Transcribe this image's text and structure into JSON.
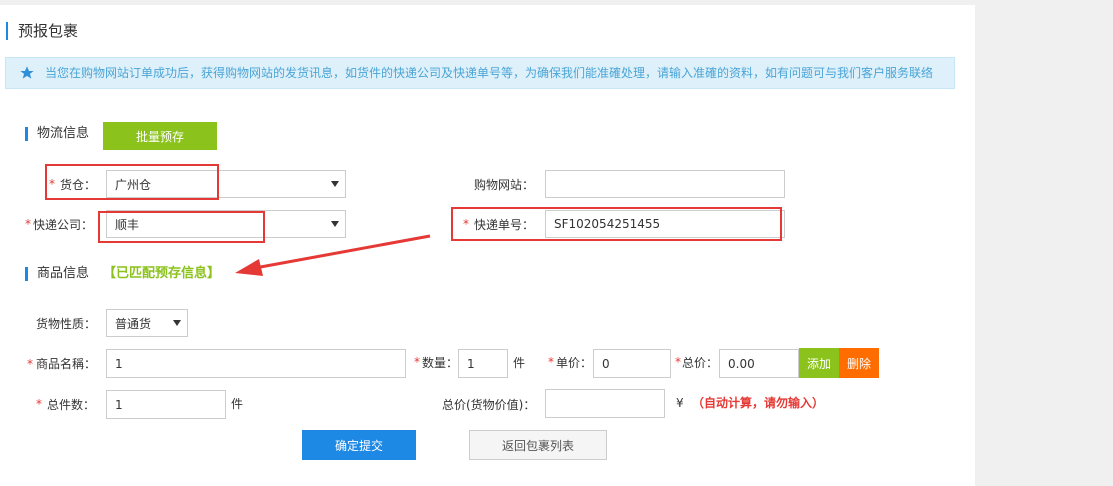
{
  "page": {
    "title": "预报包裹"
  },
  "notice": {
    "text": "当您在购物网站订单成功后，获得购物网站的发货讯息，如货件的快递公司及快递单号等，为确保我们能准確处理，请输入准確的资料，如有问题可与我们客户服务联络"
  },
  "logistics": {
    "title": "物流信息",
    "batch_button": "批量预存",
    "warehouse": {
      "required": "*",
      "label": "货仓：",
      "value": "广州仓"
    },
    "shop_site": {
      "label": "购物网站：",
      "value": ""
    },
    "courier": {
      "required": "*",
      "label": "快递公司：",
      "value": "顺丰"
    },
    "tracking": {
      "required": "*",
      "label": "快递单号：",
      "value": "SF102054251455"
    }
  },
  "goods": {
    "title": "商品信息",
    "matched_note": "【已匹配预存信息】",
    "nature": {
      "label": "货物性质：",
      "value": "普通货"
    },
    "name": {
      "required": "*",
      "label": "商品名稱：",
      "value": "1"
    },
    "quantity": {
      "required": "*",
      "label": "数量：",
      "value": "1",
      "unit": "件"
    },
    "unit_price": {
      "required": "*",
      "label": "单价：",
      "value": "0"
    },
    "total_price": {
      "required": "*",
      "label": "总价：",
      "value": "0.00"
    },
    "add_button": "添加",
    "delete_button": "删除",
    "total_count": {
      "required": "*",
      "label": "总件数：",
      "value": "1",
      "unit": "件"
    },
    "total_value": {
      "label": "总价(货物价值)：",
      "value": "",
      "currency": "¥",
      "hint": "（自动计算，请勿输入）"
    }
  },
  "actions": {
    "submit": "确定提交",
    "back": "返回包裹列表"
  },
  "colors": {
    "accent_blue": "#1e88e5",
    "green": "#8bc21c",
    "orange": "#ff6d00",
    "red": "#e53935"
  }
}
